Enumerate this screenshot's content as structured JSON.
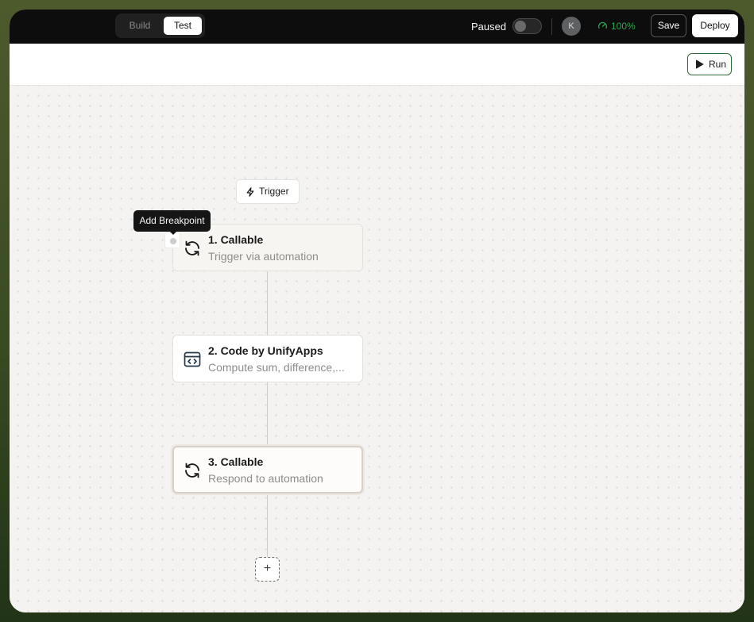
{
  "topbar": {
    "modes": {
      "build": "Build",
      "test": "Test"
    },
    "active_mode": "Test",
    "paused_label": "Paused",
    "paused_on": false,
    "avatar_initial": "K",
    "health_value": "100%",
    "save_label": "Save",
    "deploy_label": "Deploy"
  },
  "subbar": {
    "run_label": "Run"
  },
  "canvas": {
    "trigger_label": "Trigger",
    "tooltip": "Add Breakpoint",
    "nodes": [
      {
        "title": "1. Callable",
        "subtitle": "Trigger via automation",
        "icon": "refresh-icon"
      },
      {
        "title": "2. Code by UnifyApps",
        "subtitle": "Compute sum, difference,...",
        "icon": "code-window-icon"
      },
      {
        "title": "3. Callable",
        "subtitle": "Respond to automation",
        "icon": "refresh-icon"
      }
    ],
    "add_step_label": "+"
  },
  "colors": {
    "topbar_bg": "#0c0d0c",
    "health_green": "#2fa34f",
    "run_border": "#2f6b3a",
    "frame_green": "#3a4a22"
  }
}
